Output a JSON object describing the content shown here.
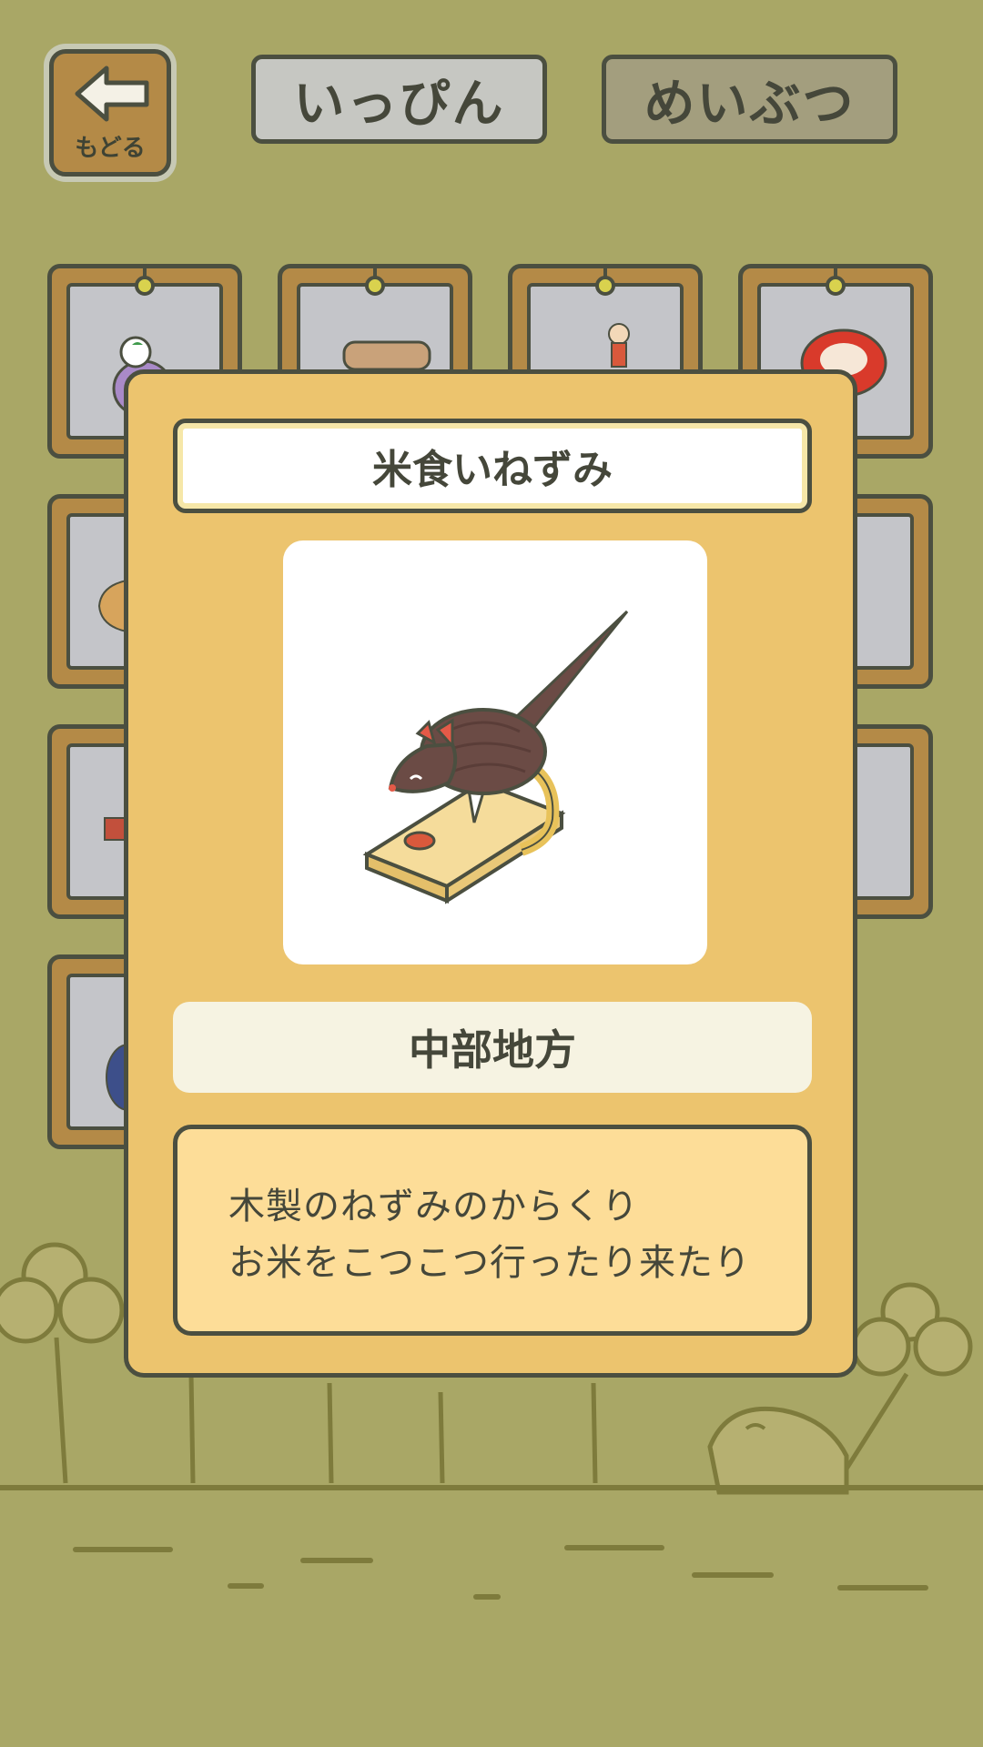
{
  "back_button": {
    "label": "もどる",
    "icon": "back-arrow-icon"
  },
  "tabs": [
    {
      "label": "いっぴん",
      "active": false
    },
    {
      "label": "めいぶつ",
      "active": true
    }
  ],
  "grid_items": [
    {
      "icon": "pigeon-toy-icon"
    },
    {
      "icon": "basket-icon"
    },
    {
      "icon": "kokeshi-doll-icon"
    },
    {
      "icon": "daruma-icon"
    },
    {
      "icon": "comb-icon"
    },
    {
      "icon": "fan-icon"
    },
    {
      "icon": "box-icon"
    },
    {
      "icon": "bag-icon"
    },
    {
      "icon": "plate-icon"
    }
  ],
  "detail": {
    "name": "米食いねずみ",
    "image_icon": "rice-eating-mouse-toy-icon",
    "region": "中部地方",
    "description_line1": "木製のねずみのからくり",
    "description_line2": "お米をこつこつ行ったり来たり"
  },
  "colors": {
    "background": "#a9a766",
    "modal": "#ecc46e",
    "wood": "#b48a47",
    "outline": "#4b4f40"
  }
}
